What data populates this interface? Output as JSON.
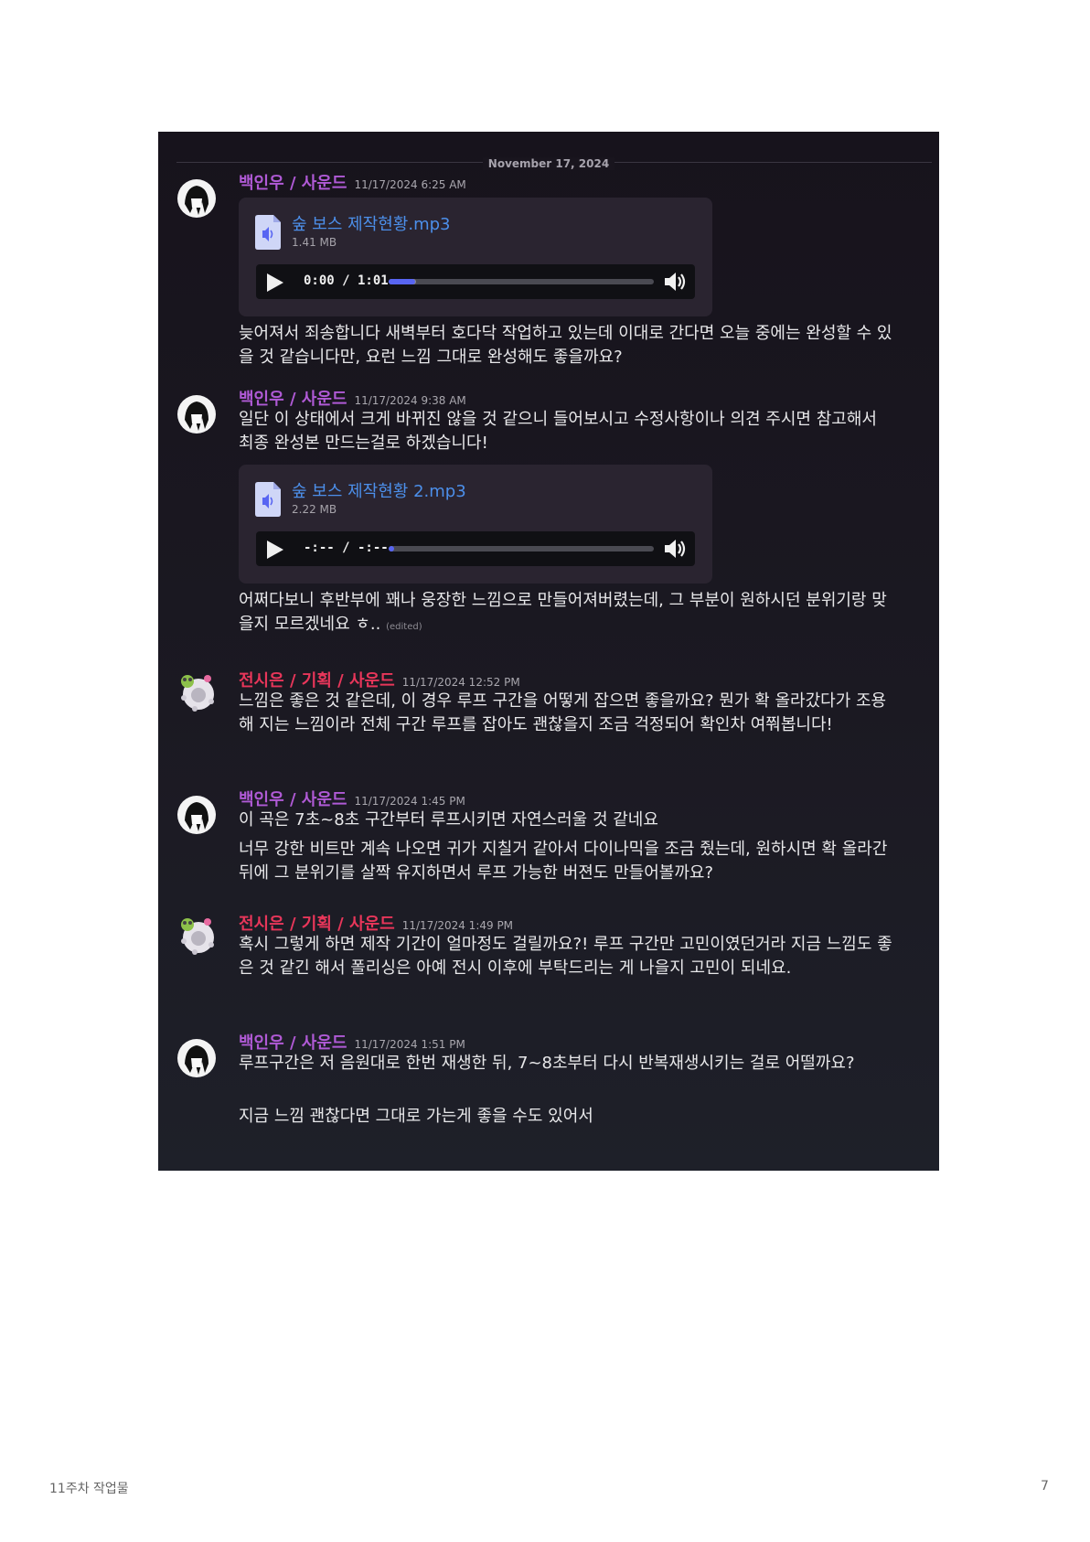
{
  "date_divider": "November 17, 2024",
  "messages": [
    {
      "author": "백인우 / 사운드",
      "timestamp": "11/17/2024 6:25 AM",
      "attachment": {
        "name": "숲 보스 제작현황.mp3",
        "size": "1.41 MB",
        "time": "0:00 / 1:01",
        "progress": 0.1
      },
      "text": "늦어져서 죄송합니다 새벽부터 호다닥 작업하고 있는데 이대로 간다면 오늘 중에는 완성할 수 있을 것 같습니다만, 요런 느낌 그대로 완성해도 좋을까요?"
    },
    {
      "author": "백인우 / 사운드",
      "timestamp": "11/17/2024 9:38 AM",
      "text": "일단 이 상태에서 크게 바뀌진 않을 것 같으니 들어보시고 수정사항이나 의견 주시면 참고해서 최종 완성본 만드는걸로 하겠습니다!",
      "attachment": {
        "name": "숲 보스 제작현황 2.mp3",
        "size": "2.22 MB",
        "time": "-:-- / -:--",
        "progress": 0.02
      },
      "text2": "어쩌다보니 후반부에 꽤나 웅장한 느낌으로 만들어져버렸는데, 그 부분이 원하시던 분위기랑 맞을지 모르겠네요 ㅎ..",
      "edited": "(edited)"
    },
    {
      "author": "전시은 / 기획 / 사운드",
      "timestamp": "11/17/2024 12:52 PM",
      "text": "느낌은 좋은 것 같은데, 이 경우 루프 구간을 어떻게 잡으면 좋을까요? 뭔가 확 올라갔다가 조용 해 지는 느낌이라 전체 구간 루프를 잡아도 괜찮을지 조금 걱정되어 확인차 여쭤봅니다!"
    },
    {
      "author": "백인우 / 사운드",
      "timestamp": "11/17/2024 1:45 PM",
      "text": "이 곡은 7초~8초 구간부터 루프시키면 자연스러울 것 같네요",
      "text2": "너무 강한 비트만 계속 나오면 귀가 지칠거 같아서 다이나믹을 조금 줬는데, 원하시면 확 올라간 뒤에 그 분위기를 살짝 유지하면서 루프 가능한 버젼도 만들어볼까요?"
    },
    {
      "author": "전시은 / 기획 / 사운드",
      "timestamp": "11/17/2024 1:49 PM",
      "text": "혹시 그렇게 하면 제작 기간이 얼마정도 걸릴까요?! 루프 구간만 고민이였던거라 지금 느낌도 좋은 것 같긴 해서 폴리싱은 아예 전시 이후에 부탁드리는 게 나을지 고민이 되네요."
    },
    {
      "author": "백인우 / 사운드",
      "timestamp": "11/17/2024 1:51 PM",
      "text": "루프구간은 저 음원대로 한번 재생한 뒤, 7~8초부터 다시 반복재생시키는 걸로 어떨까요?",
      "text2": "지금 느낌 괜찮다면 그대로 가는게 좋을 수도 있어서"
    }
  ],
  "colors": {
    "purple_name": "#b05ad6",
    "red_name": "#e8365a",
    "link": "#4c8fea",
    "accent": "#5865f2"
  },
  "footer": {
    "left": "11주차 작업물",
    "right": "7"
  }
}
